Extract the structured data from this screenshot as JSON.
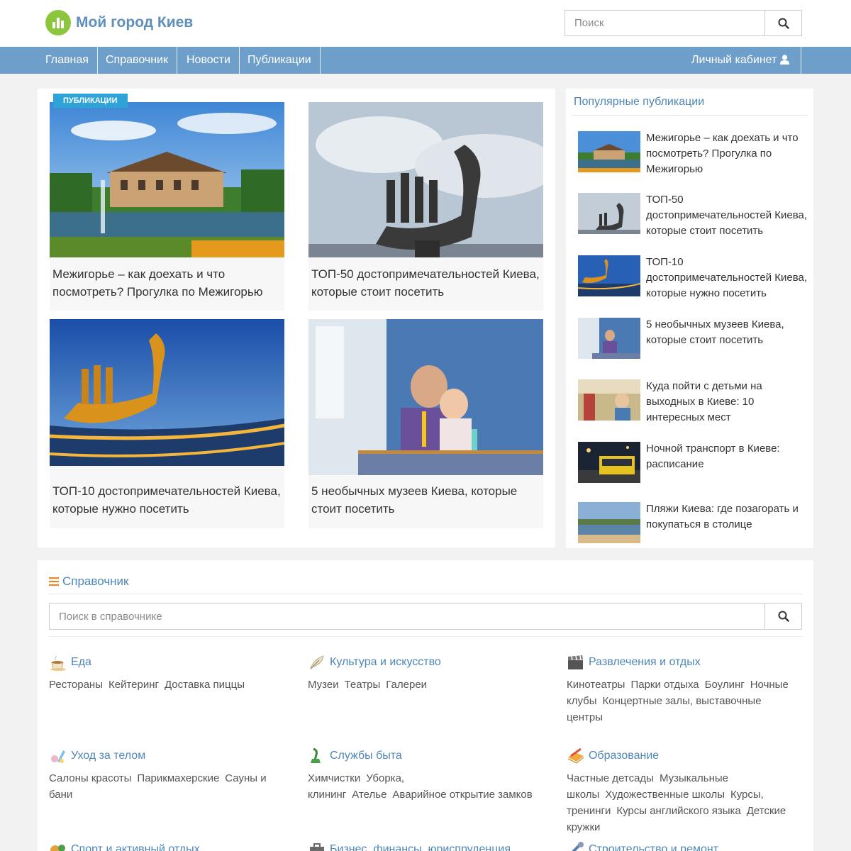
{
  "site": {
    "title": "Мой город Киев"
  },
  "search": {
    "placeholder": "Поиск"
  },
  "nav": {
    "items": [
      "Главная",
      "Справочник",
      "Новости",
      "Публикации"
    ],
    "cabinet": "Личный кабинет"
  },
  "main": {
    "badge": "ПУБЛИКАЦИИ",
    "cards": [
      {
        "title": "Межигорье – как доехать и что посмотреть? Прогулка по Межигорью"
      },
      {
        "title": "ТОП-50 достопримечательностей Киева, которые стоит посетить"
      },
      {
        "title": "ТОП-10 достопримечательностей Киева, которые нужно посетить"
      },
      {
        "title": "5 необычных музеев Киева, которые стоит посетить"
      }
    ]
  },
  "sidebar": {
    "title": "Популярные публикации",
    "items": [
      {
        "title": "Межигорье – как доехать и что посмотреть? Прогулка по Межигорью"
      },
      {
        "title": "ТОП-50 достопримечательностей Киева, которые стоит посетить"
      },
      {
        "title": "ТОП-10 достопримечательностей Киева, которые нужно посетить"
      },
      {
        "title": "5 необычных музеев Киева, которые стоит посетить"
      },
      {
        "title": "Куда пойти с детьми на выходных в Киеве: 10 интересных мест"
      },
      {
        "title": "Ночной транспорт в Киеве: расписание"
      },
      {
        "title": "Пляжи Киева: где позагорать и покупаться в столице"
      }
    ]
  },
  "directory": {
    "title": "Справочник",
    "search_placeholder": "Поиск в справочнике",
    "categories": [
      {
        "name": "Еда",
        "icon": "coffee-cup-icon",
        "links": [
          "Рестораны",
          "Кейтеринг",
          "Доставка пиццы"
        ]
      },
      {
        "name": "Культура и искусство",
        "icon": "feather-icon",
        "links": [
          "Музеи",
          "Театры",
          "Галереи"
        ]
      },
      {
        "name": "Развлечения и отдых",
        "icon": "clapperboard-icon",
        "links": [
          "Кинотеатры",
          "Парки отдыха",
          "Боулинг",
          "Ночные клубы",
          "Концертные залы, выставочные центры"
        ]
      },
      {
        "name": "Уход за телом",
        "icon": "spa-icon",
        "links": [
          "Салоны красоты",
          "Парикмахерские",
          "Сауны и бани"
        ]
      },
      {
        "name": "Службы быта",
        "icon": "iron-icon",
        "links": [
          "Химчистки",
          "Уборка, клининг",
          "Ателье",
          "Аварийное открытие замков"
        ]
      },
      {
        "name": "Образование",
        "icon": "pencil-book-icon",
        "links": [
          "Частные детсады",
          "Музыкальные школы",
          "Художественные школы",
          "Курсы, тренинги",
          "Курсы английского языка",
          "Детские кружки"
        ]
      },
      {
        "name": "Спорт и активный отдых",
        "icon": "sport-icon",
        "links": []
      },
      {
        "name": "Бизнес, финансы, юриспруденция",
        "icon": "briefcase-icon",
        "links": []
      },
      {
        "name": "Строительство и ремонт",
        "icon": "tools-icon",
        "links": []
      }
    ]
  },
  "colors": {
    "brand": "#5e8fbd",
    "nav": "#6e9fcb",
    "badge": "#2ea3d8",
    "logo": "#8cc63f"
  }
}
